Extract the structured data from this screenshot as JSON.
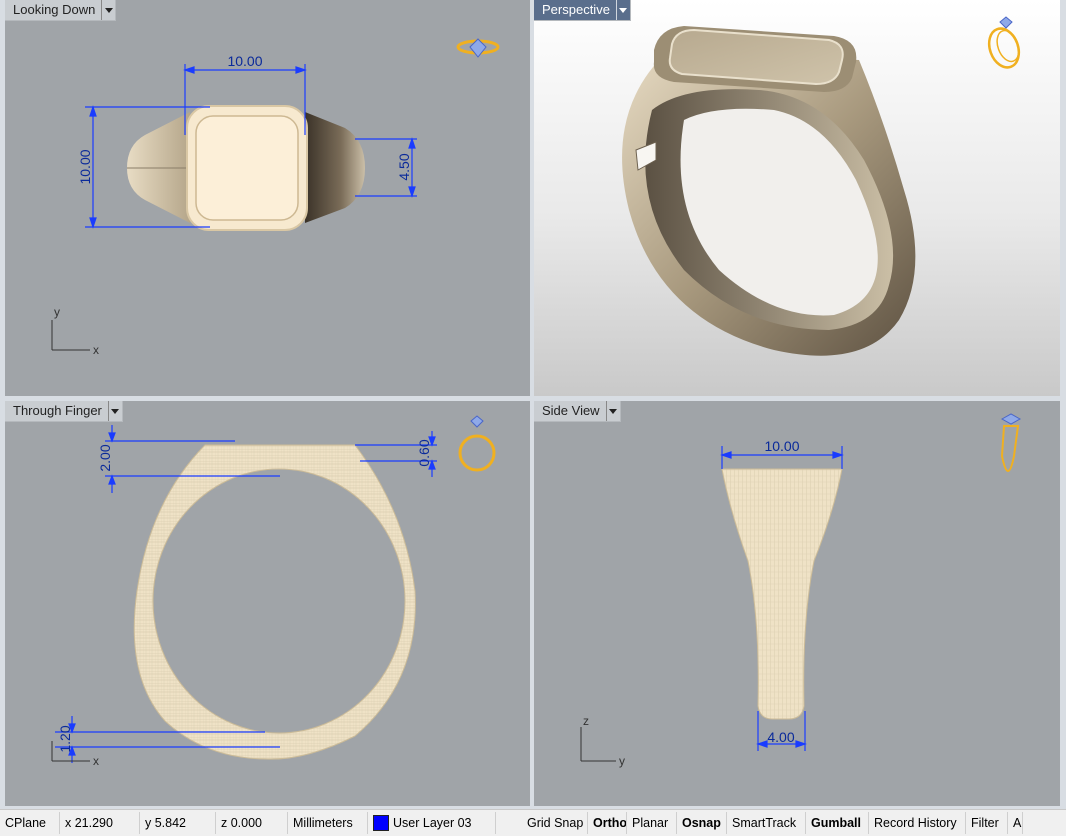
{
  "viewports": {
    "top": {
      "title": "Looking Down",
      "dims": {
        "width": "10.00",
        "height": "10.00",
        "shank": "4.50"
      },
      "axes": {
        "v": "y",
        "h": "x"
      }
    },
    "perspective": {
      "title": "Perspective"
    },
    "front": {
      "title": "Through Finger",
      "dims": {
        "top_thickness": "2.00",
        "rim": "0.60",
        "bottom_thickness": "1.20"
      },
      "axes": {
        "h": "x"
      }
    },
    "side": {
      "title": "Side View",
      "dims": {
        "top_width": "10.00",
        "bottom_width": "4.00"
      },
      "axes": {
        "v": "z",
        "h": "y"
      }
    }
  },
  "status": {
    "cplane": "CPlane",
    "x": "x 21.290",
    "y": "y 5.842",
    "z": "z 0.000",
    "units": "Millimeters",
    "layer": "User Layer 03",
    "layer_color": "#0000ff",
    "toggles": [
      {
        "label": "Grid Snap",
        "bold": false
      },
      {
        "label": "Ortho",
        "bold": true
      },
      {
        "label": "Planar",
        "bold": false
      },
      {
        "label": "Osnap",
        "bold": true
      },
      {
        "label": "SmartTrack",
        "bold": false
      },
      {
        "label": "Gumball",
        "bold": true
      },
      {
        "label": "Record History",
        "bold": false
      },
      {
        "label": "Filter",
        "bold": false
      },
      {
        "label": "A",
        "bold": false
      }
    ]
  },
  "colors": {
    "viewport_bg": "#a0a4a8",
    "dimension": "#1a3cff",
    "ring_icon": "#f0b020",
    "wire": "#f3e6cc"
  }
}
